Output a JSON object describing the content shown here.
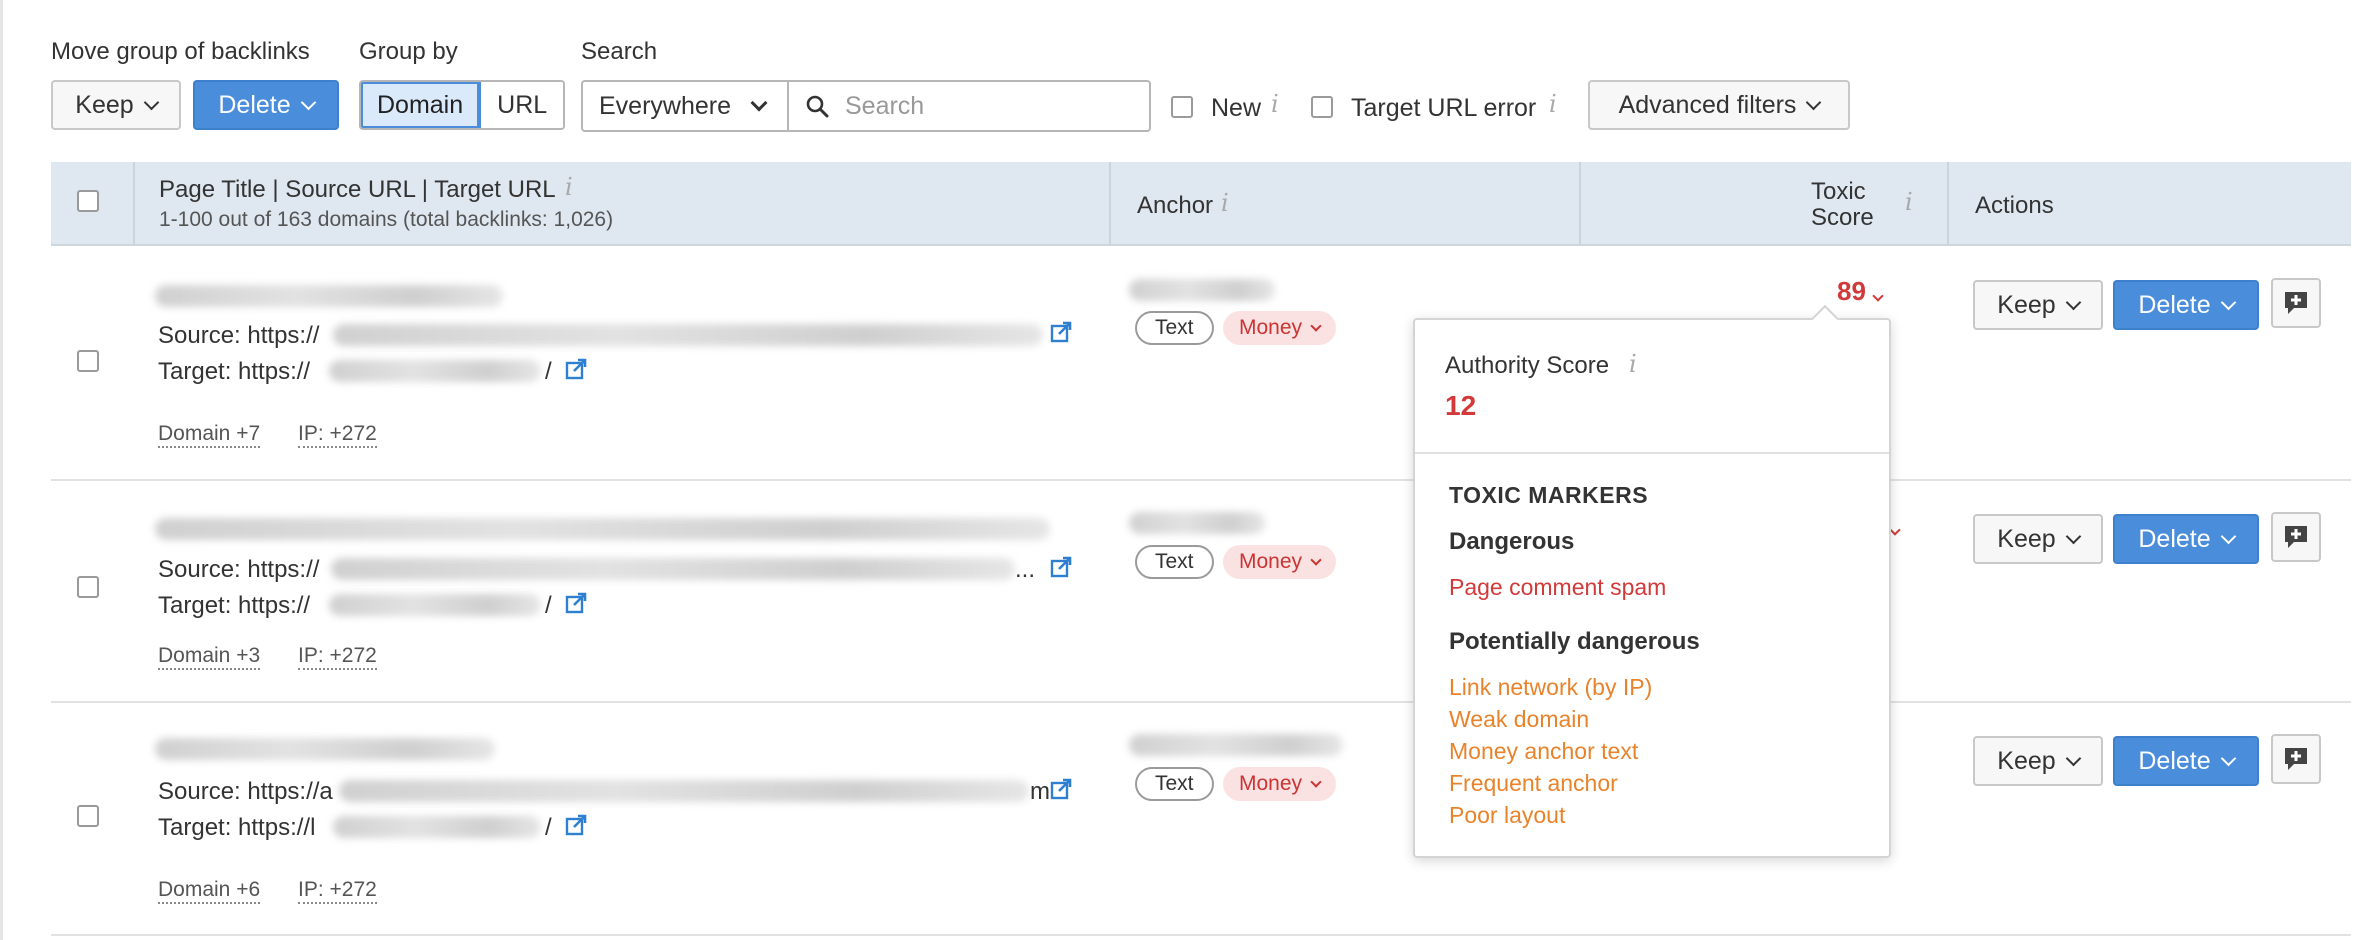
{
  "toolbar": {
    "move_group_label": "Move group of backlinks",
    "keep_label": "Keep",
    "delete_label": "Delete",
    "group_by_label": "Group by",
    "group_by_options": [
      "Domain",
      "URL"
    ],
    "group_by_selected": "Domain",
    "search_label": "Search",
    "search_scope": "Everywhere",
    "search_placeholder": "Search",
    "new_label": "New",
    "target_url_error_label": "Target URL error",
    "advanced_filters_label": "Advanced filters"
  },
  "table": {
    "columns": {
      "page": "Page Title | Source URL | Target URL",
      "page_sub": "1-100 out of 163 domains (total backlinks: 1,026)",
      "anchor": "Anchor",
      "toxic_line1": "Toxic",
      "toxic_line2": "Score",
      "actions": "Actions"
    },
    "rows": [
      {
        "source_prefix": "Source: https://",
        "target_prefix": "Target: https://",
        "target_suffix": "/",
        "domain_link": "Domain +7",
        "ip_link": "IP: +272",
        "anchor_type": "Text",
        "anchor_tag": "Money",
        "toxic_score": "89",
        "keep": "Keep",
        "delete": "Delete"
      },
      {
        "source_prefix": "Source: https://",
        "source_suffix": "...",
        "target_prefix": "Target: https://",
        "target_suffix": "/",
        "domain_link": "Domain +3",
        "ip_link": "IP: +272",
        "anchor_type": "Text",
        "anchor_tag": "Money",
        "keep": "Keep",
        "delete": "Delete"
      },
      {
        "source_prefix": "Source: https://a",
        "source_suffix": "m",
        "target_prefix": "Target: https://l",
        "target_suffix": "/",
        "domain_link": "Domain +6",
        "ip_link": "IP: +272",
        "anchor_type": "Text",
        "anchor_tag": "Money",
        "keep": "Keep",
        "delete": "Delete"
      }
    ]
  },
  "popover": {
    "authority_label": "Authority Score",
    "authority_value": "12",
    "markers_title": "TOXIC MARKERS",
    "dangerous_title": "Dangerous",
    "dangerous_items": [
      "Page comment spam"
    ],
    "potential_title": "Potentially dangerous",
    "potential_items": [
      "Link network (by IP)",
      "Weak domain",
      "Money anchor text",
      "Frequent anchor",
      "Poor layout"
    ]
  },
  "colors": {
    "accent_blue": "#4a8ddb",
    "toxic_red": "#d23a3a",
    "warning_orange": "#e9832b",
    "header_bg": "#dfe8f1"
  },
  "icons": {
    "external_link": "external-link-icon",
    "search": "search-icon",
    "comment": "add-comment-icon",
    "info": "info-icon"
  }
}
